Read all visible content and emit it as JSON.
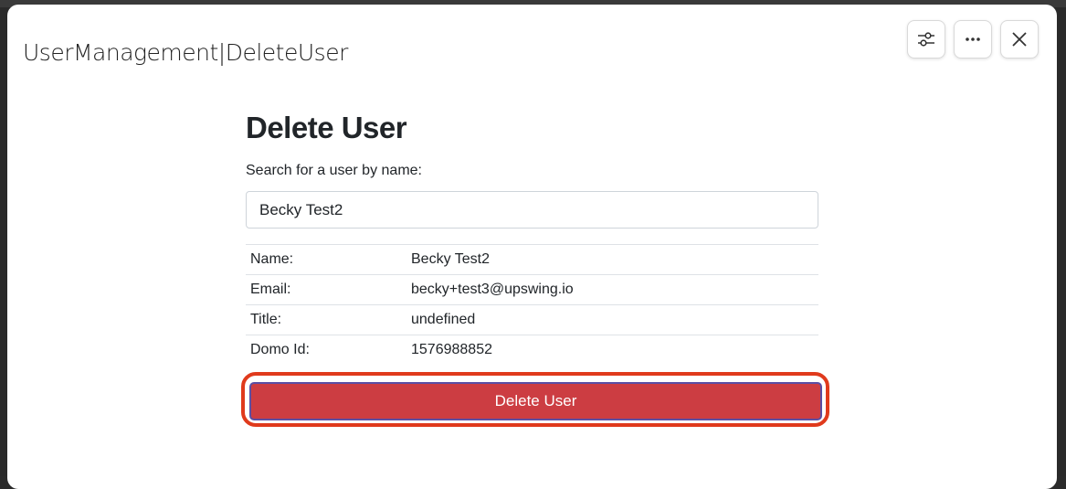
{
  "modal": {
    "title": "UserManagement|DeleteUser",
    "actions": [
      {
        "icon": "sliders-icon"
      },
      {
        "icon": "more-horizontal-icon"
      },
      {
        "icon": "close-icon"
      }
    ]
  },
  "form": {
    "heading": "Delete User",
    "search_label": "Search for a user by name:",
    "search_value": "Becky Test2"
  },
  "details": {
    "rows": [
      {
        "label": "Name:",
        "value": "Becky Test2"
      },
      {
        "label": "Email:",
        "value": "becky+test3@upswing.io"
      },
      {
        "label": "Title:",
        "value": "undefined"
      },
      {
        "label": "Domo Id:",
        "value": "1576988852"
      }
    ]
  },
  "delete_button": {
    "label": "Delete User"
  },
  "colors": {
    "danger": "#cc3d42",
    "highlight": "#e03a1c"
  }
}
